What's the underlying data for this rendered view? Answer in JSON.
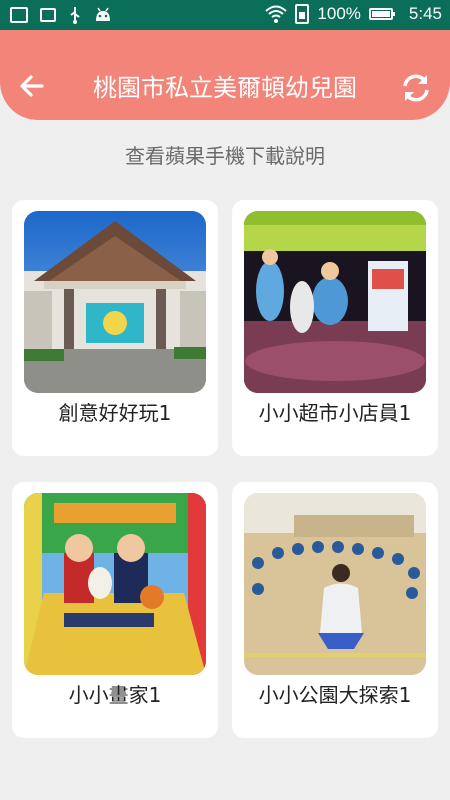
{
  "status_bar": {
    "battery_percent": "100%",
    "time": "5:45",
    "left_icons": [
      "screenshot-icon",
      "code-icon",
      "usb-icon",
      "android-icon"
    ],
    "right_icons": [
      "wifi-icon",
      "sim-icon",
      "battery-icon"
    ]
  },
  "header": {
    "title": "桃園市私立美爾頓幼兒園",
    "back_icon": "back-arrow-icon",
    "refresh_icon": "refresh-icon"
  },
  "subtitle": "查看蘋果手機下載說明",
  "colors": {
    "status_bar": "#0a6e58",
    "header": "#f2847a",
    "background": "#efefef",
    "card": "#ffffff"
  },
  "cards": [
    {
      "label": "創意好好玩1"
    },
    {
      "label": "小小超市小店員1"
    },
    {
      "label": "小小畫家1"
    },
    {
      "label": "小小公園大探索1"
    }
  ]
}
